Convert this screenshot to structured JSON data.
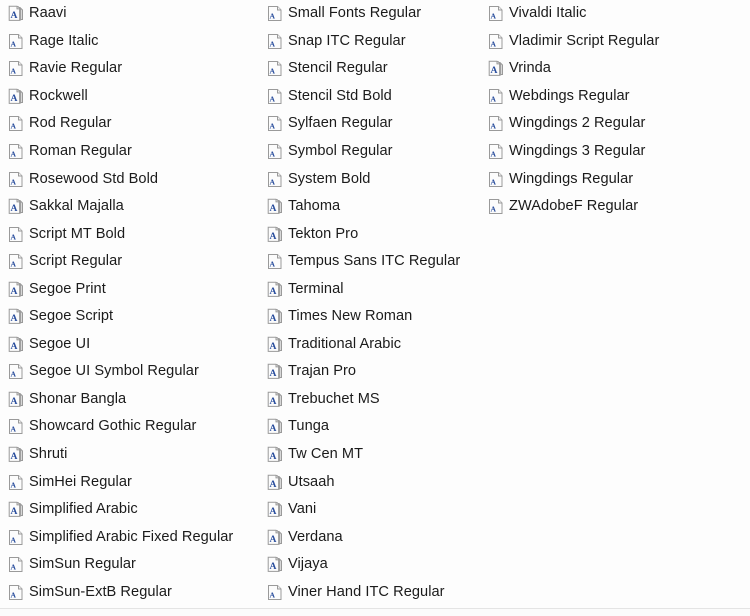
{
  "window": {
    "title": "Fonts",
    "background_color": "#fdfdfd",
    "text_color": "#1b1b1b",
    "separator_color": "#e4e4e4",
    "icon_accent_color": "#2b4f9e",
    "icon_page_fill": "#fcfcfc",
    "icon_page_border": "#9a9a9a",
    "icon_group_fill": "#dfdfdf"
  },
  "icons": {
    "font_group": "font-group-icon",
    "font_file": "font-file-icon"
  },
  "columns": [
    {
      "name": "column-1",
      "items": [
        {
          "label": "Raavi",
          "icon": "font-group-icon"
        },
        {
          "label": "Rage Italic",
          "icon": "font-file-icon"
        },
        {
          "label": "Ravie Regular",
          "icon": "font-file-icon"
        },
        {
          "label": "Rockwell",
          "icon": "font-group-icon"
        },
        {
          "label": "Rod Regular",
          "icon": "font-file-icon"
        },
        {
          "label": "Roman Regular",
          "icon": "font-file-icon"
        },
        {
          "label": "Rosewood Std Bold",
          "icon": "font-file-icon"
        },
        {
          "label": "Sakkal Majalla",
          "icon": "font-group-icon"
        },
        {
          "label": "Script MT Bold",
          "icon": "font-file-icon"
        },
        {
          "label": "Script Regular",
          "icon": "font-file-icon"
        },
        {
          "label": "Segoe Print",
          "icon": "font-group-icon"
        },
        {
          "label": "Segoe Script",
          "icon": "font-group-icon"
        },
        {
          "label": "Segoe UI",
          "icon": "font-group-icon"
        },
        {
          "label": "Segoe UI Symbol Regular",
          "icon": "font-file-icon"
        },
        {
          "label": "Shonar Bangla",
          "icon": "font-group-icon"
        },
        {
          "label": "Showcard Gothic Regular",
          "icon": "font-file-icon"
        },
        {
          "label": "Shruti",
          "icon": "font-group-icon"
        },
        {
          "label": "SimHei Regular",
          "icon": "font-file-icon"
        },
        {
          "label": "Simplified Arabic",
          "icon": "font-group-icon"
        },
        {
          "label": "Simplified Arabic Fixed Regular",
          "icon": "font-file-icon"
        },
        {
          "label": "SimSun Regular",
          "icon": "font-file-icon"
        },
        {
          "label": "SimSun-ExtB Regular",
          "icon": "font-file-icon"
        }
      ]
    },
    {
      "name": "column-2",
      "items": [
        {
          "label": "Small Fonts Regular",
          "icon": "font-file-icon"
        },
        {
          "label": "Snap ITC Regular",
          "icon": "font-file-icon"
        },
        {
          "label": "Stencil Regular",
          "icon": "font-file-icon"
        },
        {
          "label": "Stencil Std Bold",
          "icon": "font-file-icon"
        },
        {
          "label": "Sylfaen Regular",
          "icon": "font-file-icon"
        },
        {
          "label": "Symbol Regular",
          "icon": "font-file-icon"
        },
        {
          "label": "System Bold",
          "icon": "font-file-icon"
        },
        {
          "label": "Tahoma",
          "icon": "font-group-icon"
        },
        {
          "label": "Tekton Pro",
          "icon": "font-group-icon"
        },
        {
          "label": "Tempus Sans ITC Regular",
          "icon": "font-file-icon"
        },
        {
          "label": "Terminal",
          "icon": "font-group-icon"
        },
        {
          "label": "Times New Roman",
          "icon": "font-group-icon"
        },
        {
          "label": "Traditional Arabic",
          "icon": "font-group-icon"
        },
        {
          "label": "Trajan Pro",
          "icon": "font-group-icon"
        },
        {
          "label": "Trebuchet MS",
          "icon": "font-group-icon"
        },
        {
          "label": "Tunga",
          "icon": "font-group-icon"
        },
        {
          "label": "Tw Cen MT",
          "icon": "font-group-icon"
        },
        {
          "label": "Utsaah",
          "icon": "font-group-icon"
        },
        {
          "label": "Vani",
          "icon": "font-group-icon"
        },
        {
          "label": "Verdana",
          "icon": "font-group-icon"
        },
        {
          "label": "Vijaya",
          "icon": "font-group-icon"
        },
        {
          "label": "Viner Hand ITC Regular",
          "icon": "font-file-icon"
        }
      ]
    },
    {
      "name": "column-3",
      "items": [
        {
          "label": "Vivaldi Italic",
          "icon": "font-file-icon"
        },
        {
          "label": "Vladimir Script Regular",
          "icon": "font-file-icon"
        },
        {
          "label": "Vrinda",
          "icon": "font-group-icon"
        },
        {
          "label": "Webdings Regular",
          "icon": "font-file-icon"
        },
        {
          "label": "Wingdings 2 Regular",
          "icon": "font-file-icon"
        },
        {
          "label": "Wingdings 3 Regular",
          "icon": "font-file-icon"
        },
        {
          "label": "Wingdings Regular",
          "icon": "font-file-icon"
        },
        {
          "label": "ZWAdobeF Regular",
          "icon": "font-file-icon"
        }
      ]
    }
  ]
}
